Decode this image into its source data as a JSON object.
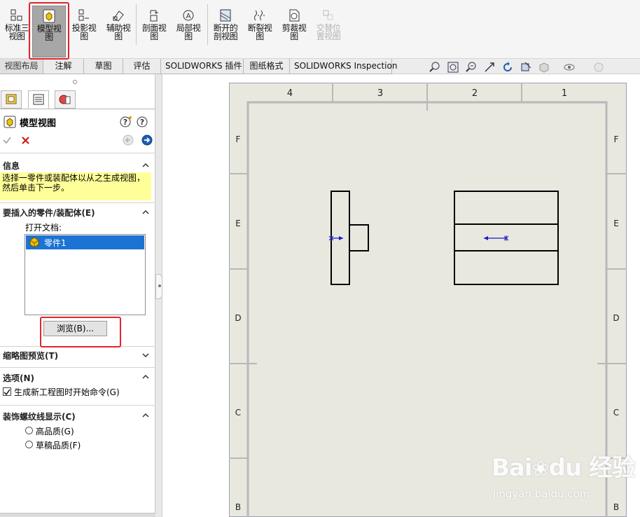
{
  "toolbar": {
    "buttons": [
      {
        "label": "标准三\n视图",
        "icon": "standard-3-view-icon",
        "state": "normal"
      },
      {
        "label": "模型视\n图",
        "icon": "model-view-icon",
        "state": "active"
      },
      {
        "label": "投影视\n图",
        "icon": "projected-view-icon",
        "state": "normal"
      },
      {
        "label": "辅助视\n图",
        "icon": "auxiliary-view-icon",
        "state": "normal"
      },
      {
        "label": "剖面视\n图",
        "icon": "section-view-icon",
        "state": "normal"
      },
      {
        "label": "局部视\n图",
        "icon": "detail-view-icon",
        "state": "normal"
      },
      {
        "label": "断开的\n剖视图",
        "icon": "broken-out-section-icon",
        "state": "normal"
      },
      {
        "label": "断裂视\n图",
        "icon": "break-view-icon",
        "state": "normal"
      },
      {
        "label": "剪裁视\n图",
        "icon": "crop-view-icon",
        "state": "normal"
      },
      {
        "label": "交替位\n置视图",
        "icon": "alternate-position-view-icon",
        "state": "disabled"
      }
    ]
  },
  "tabs": [
    "视图布局",
    "注解",
    "草图",
    "评估",
    "SOLIDWORKS 插件",
    "图纸格式",
    "SOLIDWORKS Inspection"
  ],
  "view_icons": [
    "zoom-to-fit-icon",
    "zoom-area-icon",
    "zoom-previous-icon",
    "select-icon",
    "rotate-icon",
    "section-icon",
    "display-style-icon",
    "hide-show-icon",
    "appearance-icon"
  ],
  "panel": {
    "title": "模型视图",
    "help_icons": [
      "help-icon",
      "question-icon"
    ],
    "ok_icon": "checkmark-icon",
    "cancel_icon": "x-icon",
    "back_icon": "back-arrow-icon",
    "next_icon": "next-arrow-icon",
    "info": {
      "header": "信息",
      "text": "选择一零件或装配体以从之生成视图，然后单击下一步。"
    },
    "part_section": {
      "header": "要插入的零件/装配体(E)",
      "open_docs_label": "打开文档:",
      "documents": [
        "零件1"
      ],
      "browse_label": "浏览(B)..."
    },
    "thumbnail_header": "缩略图预览(T)",
    "options": {
      "header": "选项(N)",
      "checkbox_label": "生成新工程图时开始命令(G)",
      "checked": true
    },
    "cosmetic_thread": {
      "header": "装饰螺纹线显示(C)",
      "options": [
        "高品质(G)",
        "草稿品质(F)"
      ]
    }
  },
  "sheet": {
    "column_labels": [
      "4",
      "3",
      "2",
      "1"
    ],
    "row_labels": [
      "F",
      "E",
      "D",
      "C",
      "B"
    ]
  },
  "watermark": {
    "brand": "Bai",
    "brand2": "du",
    "cn": "经验",
    "url": "jingyan.baidu.com"
  },
  "colors": {
    "highlight_red": "#e0252b",
    "selection_blue": "#1b73d3",
    "info_yellow": "#ffff99",
    "sheet_bg": "#e9e8df",
    "arrow_blue": "#1818c8"
  }
}
